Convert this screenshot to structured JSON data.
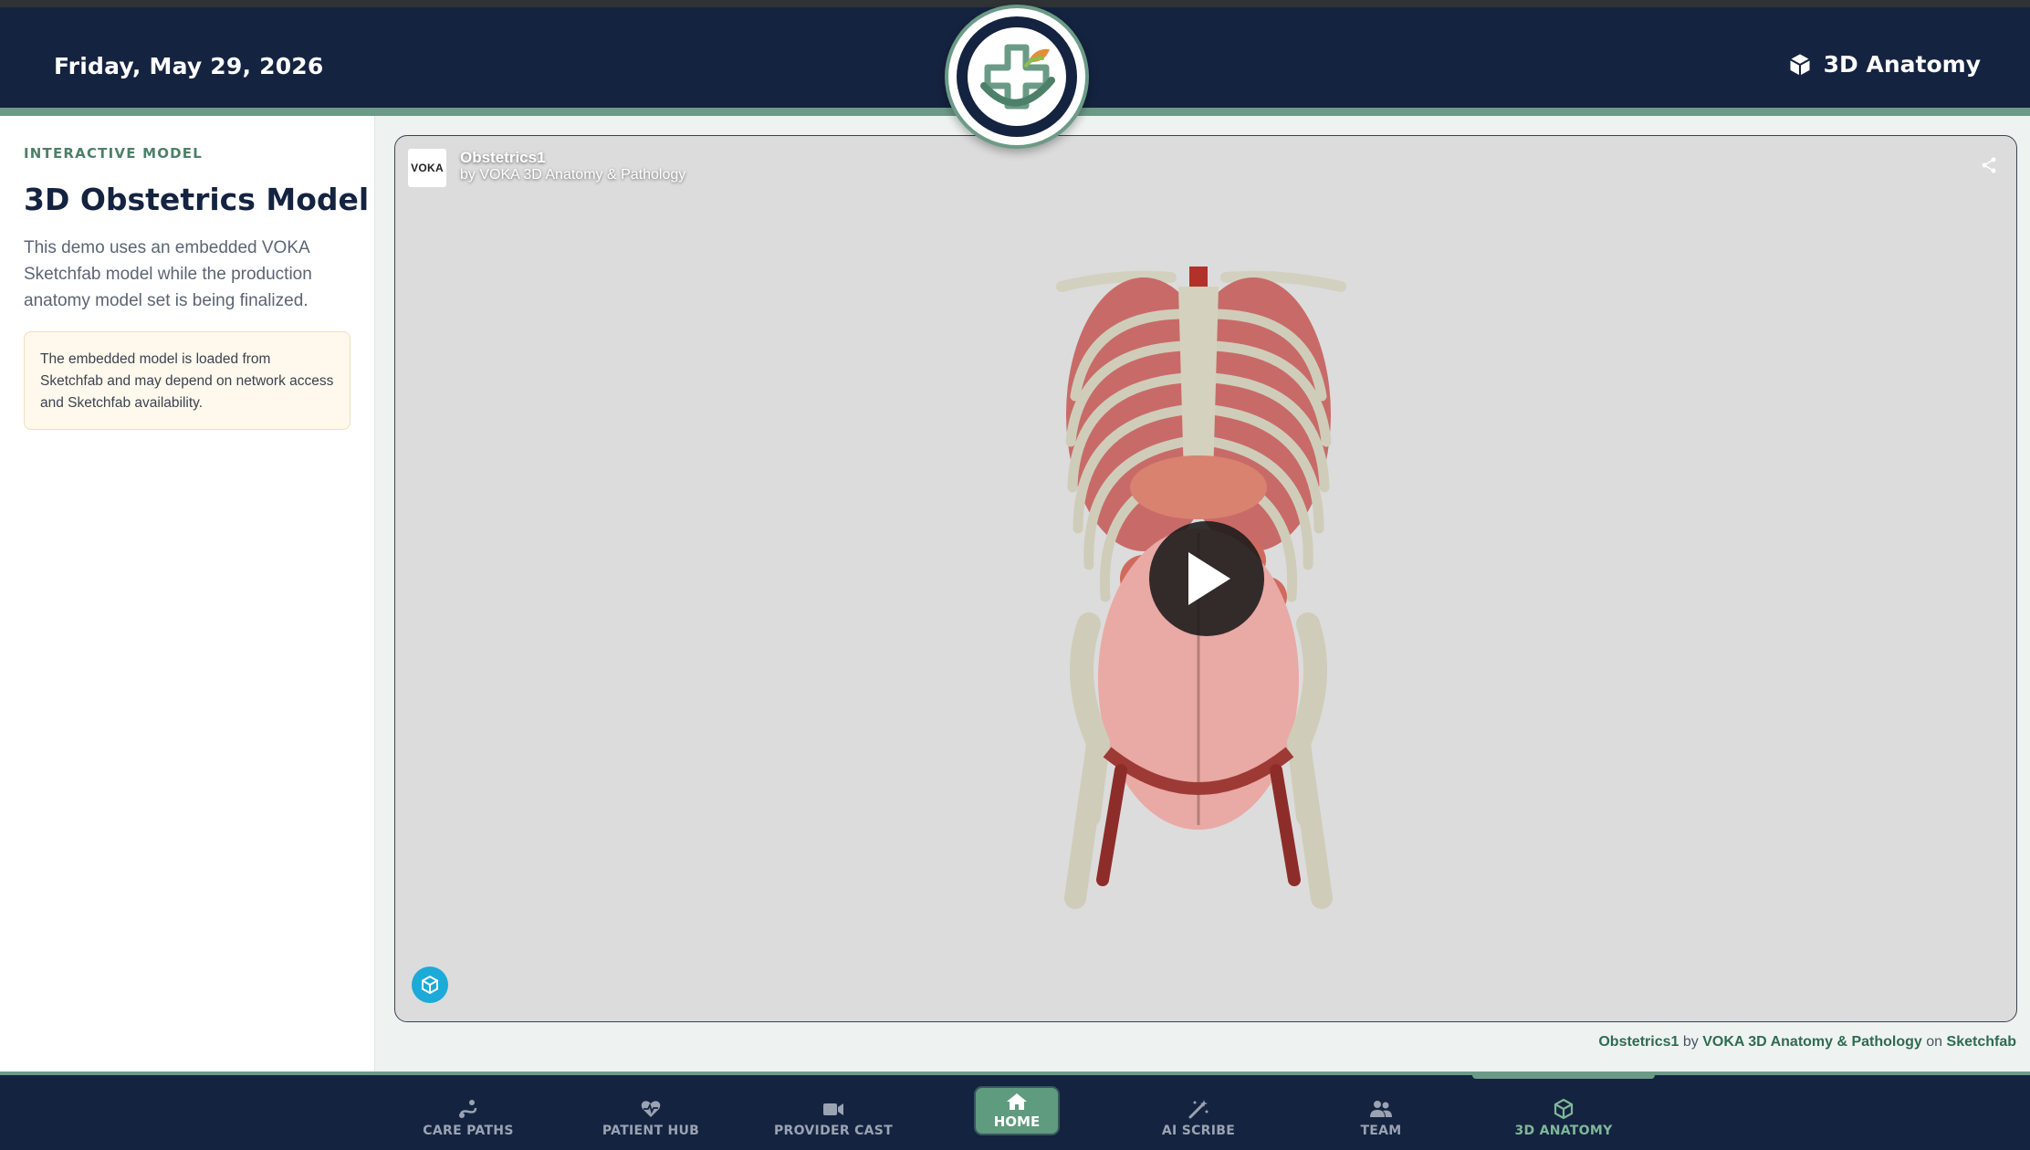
{
  "header": {
    "date": "Friday, May 29, 2026",
    "page_label": "3D Anatomy",
    "page_icon": "cube-icon"
  },
  "sidebar": {
    "eyebrow": "INTERACTIVE MODEL",
    "title": "3D Obstetrics Model",
    "description": "This demo uses an embedded VOKA Sketchfab model while the production anatomy model set is being finalized.",
    "notice": "The embedded model is loaded from Sketchfab and may depend on network access and Sketchfab availability."
  },
  "viewer": {
    "avatar_text": "VOKA",
    "model_title": "Obstetrics1",
    "model_author": "by VOKA 3D Anatomy & Pathology"
  },
  "credit": {
    "model": "Obstetrics1",
    "by": "by",
    "author": "VOKA 3D Anatomy & Pathology",
    "on": "on",
    "platform": "Sketchfab"
  },
  "nav": {
    "items": [
      {
        "label": "CARE PATHS",
        "icon": "care-paths-icon"
      },
      {
        "label": "PATIENT HUB",
        "icon": "heart-pulse-icon"
      },
      {
        "label": "PROVIDER CAST",
        "icon": "video-camera-icon"
      },
      {
        "label": "HOME",
        "icon": "home-icon"
      },
      {
        "label": "AI SCRIBE",
        "icon": "magic-wand-icon"
      },
      {
        "label": "TEAM",
        "icon": "team-icon"
      },
      {
        "label": "3D ANATOMY",
        "icon": "cube-icon"
      }
    ],
    "active": "3D ANATOMY"
  },
  "colors": {
    "navy": "#142340",
    "accent_green": "#6b9b86",
    "active_green": "#7fb79a",
    "notice_bg": "#fff8ec"
  }
}
